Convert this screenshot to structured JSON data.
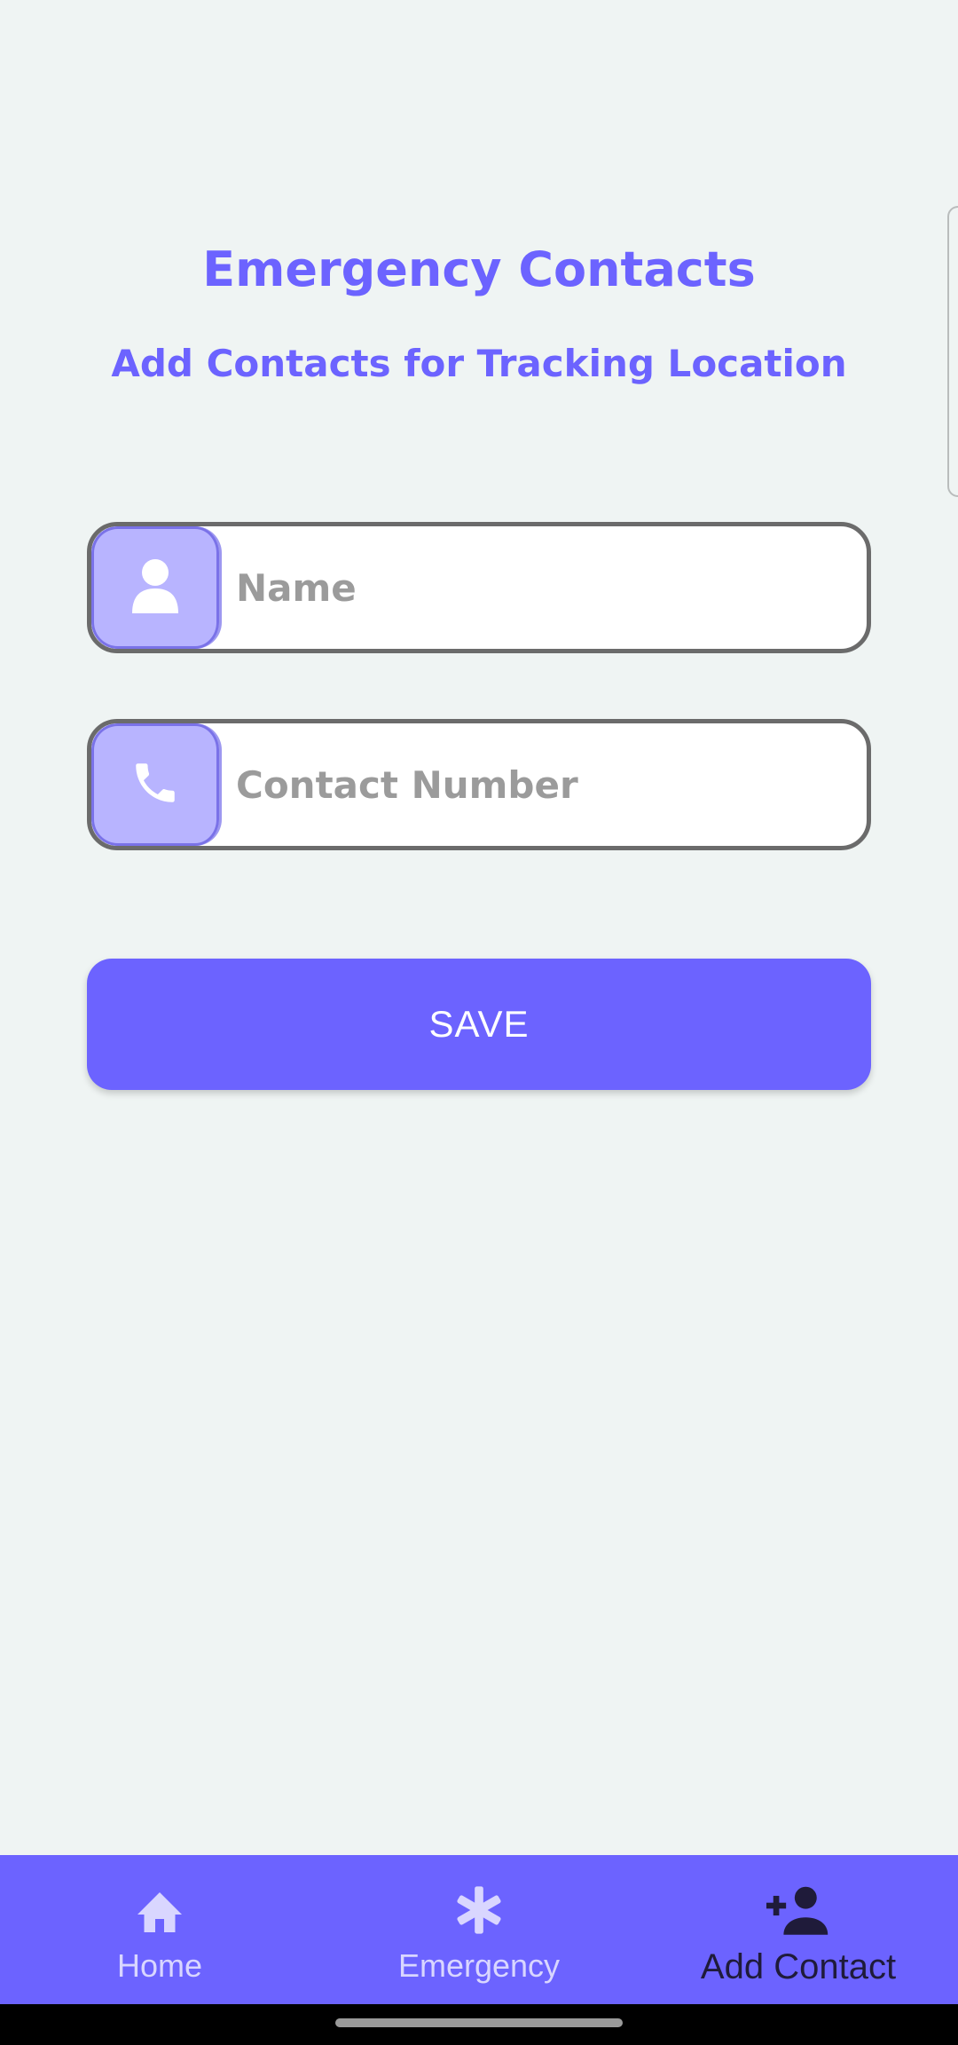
{
  "header": {
    "title": "Emergency Contacts",
    "subtitle": "Add Contacts for Tracking Location"
  },
  "form": {
    "name_placeholder": "Name",
    "name_value": "",
    "phone_placeholder": "Contact Number",
    "phone_value": "",
    "save_label": "SAVE"
  },
  "icons": {
    "name_field": "person-icon",
    "phone_field": "phone-icon"
  },
  "bottom_nav": {
    "items": [
      {
        "label": "Home",
        "icon": "home-icon",
        "active": false
      },
      {
        "label": "Emergency",
        "icon": "asterisk-icon",
        "active": false
      },
      {
        "label": "Add Contact",
        "icon": "add-person-icon",
        "active": true
      }
    ]
  },
  "colors": {
    "accent": "#6c63ff",
    "icon_box": "#b8b4ff",
    "background": "#eff4f3",
    "active_nav": "#1f1b3a",
    "inactive_nav": "#d9d6ff"
  }
}
